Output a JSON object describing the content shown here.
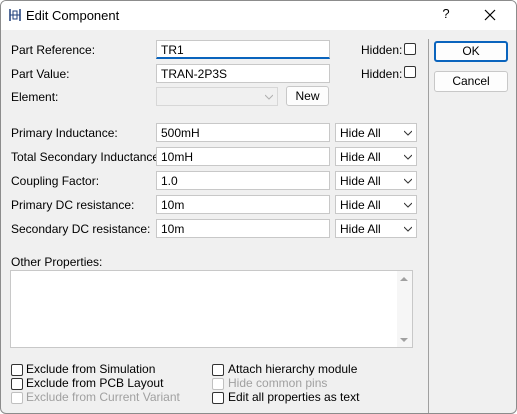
{
  "window": {
    "title": "Edit Component",
    "help": "?"
  },
  "fields": {
    "part_reference": {
      "label": "Part Reference:",
      "value": "TR1"
    },
    "part_value": {
      "label": "Part Value:",
      "value": "TRAN-2P3S"
    },
    "element": {
      "label": "Element:",
      "value": ""
    }
  },
  "hidden_label": "Hidden:",
  "new_button": "New",
  "properties": [
    {
      "label": "Primary Inductance:",
      "value": "500mH",
      "visibility": "Hide All"
    },
    {
      "label": "Total Secondary Inductance:",
      "value": "10mH",
      "visibility": "Hide All"
    },
    {
      "label": "Coupling Factor:",
      "value": "1.0",
      "visibility": "Hide All"
    },
    {
      "label": "Primary DC resistance:",
      "value": "10m",
      "visibility": "Hide All"
    },
    {
      "label": "Secondary DC resistance:",
      "value": "10m",
      "visibility": "Hide All"
    }
  ],
  "other_properties": {
    "label": "Other Properties:",
    "value": ""
  },
  "buttons": {
    "ok": "OK",
    "cancel": "Cancel"
  },
  "options": {
    "exclude_simulation": "Exclude from Simulation",
    "exclude_pcb": "Exclude from PCB Layout",
    "exclude_variant": "Exclude from Current Variant",
    "attach_hierarchy": "Attach hierarchy module",
    "hide_common_pins": "Hide common pins",
    "edit_as_text": "Edit all properties as text"
  },
  "colors": {
    "accent": "#0a64bd",
    "disabled_text": "#a0a0a0"
  }
}
